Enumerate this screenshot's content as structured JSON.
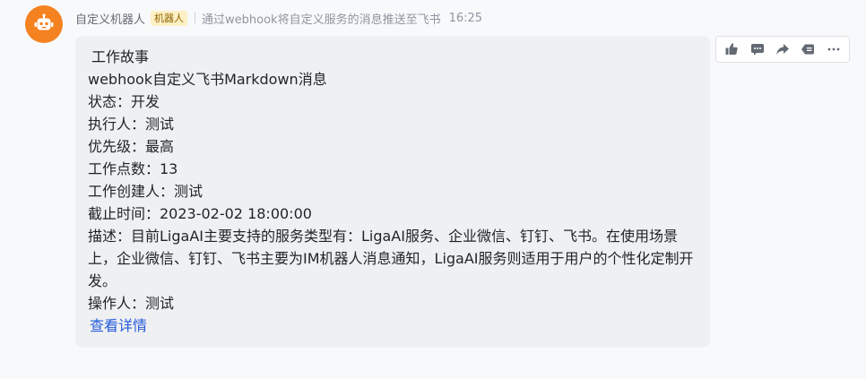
{
  "message": {
    "sender_name": "自定义机器人",
    "bot_badge": "机器人",
    "description": "通过webhook将自定义服务的消息推送至飞书",
    "time": "16:25"
  },
  "card": {
    "title": "工作故事",
    "subtitle": "webhook自定义飞书Markdown消息",
    "fields": [
      "状态：开发",
      "执行人：测试",
      "优先级：最高",
      "工作点数：13",
      "工作创建人：测试",
      "截止时间：2023-02-02 18:00:00"
    ],
    "description": "描述：目前LigaAI主要支持的服务类型有：LigaAI服务、企业微信、钉钉、飞书。在使用场景上，企业微信、钉钉、飞书主要为IM机器人消息通知，LigaAI服务则适用于用户的个性化定制开发。",
    "operator": "操作人：测试",
    "detail_link": "查看详情"
  },
  "actions": [
    "thumbs-up-icon",
    "comment-icon",
    "forward-icon",
    "pin-icon",
    "more-icon"
  ],
  "colors": {
    "avatar_bg": "#f58220",
    "bubble_bg": "#eff0f1",
    "link": "#245bdb",
    "badge_bg": "#fdf0c4",
    "badge_text": "#8f6300"
  }
}
